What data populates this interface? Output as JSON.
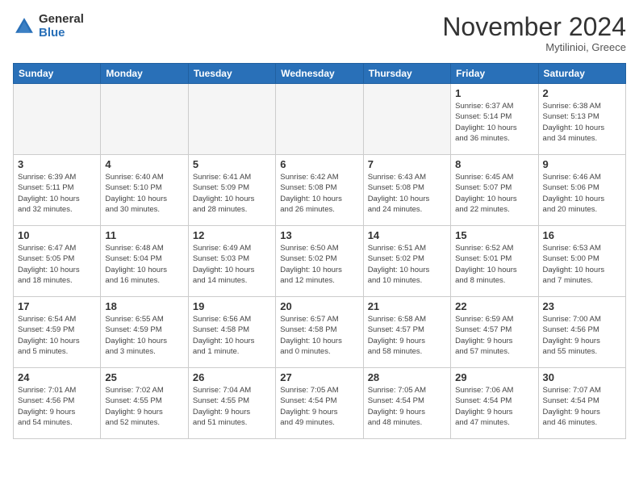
{
  "header": {
    "logo": {
      "general": "General",
      "blue": "Blue"
    },
    "title": "November 2024",
    "location": "Mytilinioi, Greece"
  },
  "weekdays": [
    "Sunday",
    "Monday",
    "Tuesday",
    "Wednesday",
    "Thursday",
    "Friday",
    "Saturday"
  ],
  "weeks": [
    [
      {
        "day": "",
        "info": ""
      },
      {
        "day": "",
        "info": ""
      },
      {
        "day": "",
        "info": ""
      },
      {
        "day": "",
        "info": ""
      },
      {
        "day": "",
        "info": ""
      },
      {
        "day": "1",
        "info": "Sunrise: 6:37 AM\nSunset: 5:14 PM\nDaylight: 10 hours\nand 36 minutes."
      },
      {
        "day": "2",
        "info": "Sunrise: 6:38 AM\nSunset: 5:13 PM\nDaylight: 10 hours\nand 34 minutes."
      }
    ],
    [
      {
        "day": "3",
        "info": "Sunrise: 6:39 AM\nSunset: 5:11 PM\nDaylight: 10 hours\nand 32 minutes."
      },
      {
        "day": "4",
        "info": "Sunrise: 6:40 AM\nSunset: 5:10 PM\nDaylight: 10 hours\nand 30 minutes."
      },
      {
        "day": "5",
        "info": "Sunrise: 6:41 AM\nSunset: 5:09 PM\nDaylight: 10 hours\nand 28 minutes."
      },
      {
        "day": "6",
        "info": "Sunrise: 6:42 AM\nSunset: 5:08 PM\nDaylight: 10 hours\nand 26 minutes."
      },
      {
        "day": "7",
        "info": "Sunrise: 6:43 AM\nSunset: 5:08 PM\nDaylight: 10 hours\nand 24 minutes."
      },
      {
        "day": "8",
        "info": "Sunrise: 6:45 AM\nSunset: 5:07 PM\nDaylight: 10 hours\nand 22 minutes."
      },
      {
        "day": "9",
        "info": "Sunrise: 6:46 AM\nSunset: 5:06 PM\nDaylight: 10 hours\nand 20 minutes."
      }
    ],
    [
      {
        "day": "10",
        "info": "Sunrise: 6:47 AM\nSunset: 5:05 PM\nDaylight: 10 hours\nand 18 minutes."
      },
      {
        "day": "11",
        "info": "Sunrise: 6:48 AM\nSunset: 5:04 PM\nDaylight: 10 hours\nand 16 minutes."
      },
      {
        "day": "12",
        "info": "Sunrise: 6:49 AM\nSunset: 5:03 PM\nDaylight: 10 hours\nand 14 minutes."
      },
      {
        "day": "13",
        "info": "Sunrise: 6:50 AM\nSunset: 5:02 PM\nDaylight: 10 hours\nand 12 minutes."
      },
      {
        "day": "14",
        "info": "Sunrise: 6:51 AM\nSunset: 5:02 PM\nDaylight: 10 hours\nand 10 minutes."
      },
      {
        "day": "15",
        "info": "Sunrise: 6:52 AM\nSunset: 5:01 PM\nDaylight: 10 hours\nand 8 minutes."
      },
      {
        "day": "16",
        "info": "Sunrise: 6:53 AM\nSunset: 5:00 PM\nDaylight: 10 hours\nand 7 minutes."
      }
    ],
    [
      {
        "day": "17",
        "info": "Sunrise: 6:54 AM\nSunset: 4:59 PM\nDaylight: 10 hours\nand 5 minutes."
      },
      {
        "day": "18",
        "info": "Sunrise: 6:55 AM\nSunset: 4:59 PM\nDaylight: 10 hours\nand 3 minutes."
      },
      {
        "day": "19",
        "info": "Sunrise: 6:56 AM\nSunset: 4:58 PM\nDaylight: 10 hours\nand 1 minute."
      },
      {
        "day": "20",
        "info": "Sunrise: 6:57 AM\nSunset: 4:58 PM\nDaylight: 10 hours\nand 0 minutes."
      },
      {
        "day": "21",
        "info": "Sunrise: 6:58 AM\nSunset: 4:57 PM\nDaylight: 9 hours\nand 58 minutes."
      },
      {
        "day": "22",
        "info": "Sunrise: 6:59 AM\nSunset: 4:57 PM\nDaylight: 9 hours\nand 57 minutes."
      },
      {
        "day": "23",
        "info": "Sunrise: 7:00 AM\nSunset: 4:56 PM\nDaylight: 9 hours\nand 55 minutes."
      }
    ],
    [
      {
        "day": "24",
        "info": "Sunrise: 7:01 AM\nSunset: 4:56 PM\nDaylight: 9 hours\nand 54 minutes."
      },
      {
        "day": "25",
        "info": "Sunrise: 7:02 AM\nSunset: 4:55 PM\nDaylight: 9 hours\nand 52 minutes."
      },
      {
        "day": "26",
        "info": "Sunrise: 7:04 AM\nSunset: 4:55 PM\nDaylight: 9 hours\nand 51 minutes."
      },
      {
        "day": "27",
        "info": "Sunrise: 7:05 AM\nSunset: 4:54 PM\nDaylight: 9 hours\nand 49 minutes."
      },
      {
        "day": "28",
        "info": "Sunrise: 7:05 AM\nSunset: 4:54 PM\nDaylight: 9 hours\nand 48 minutes."
      },
      {
        "day": "29",
        "info": "Sunrise: 7:06 AM\nSunset: 4:54 PM\nDaylight: 9 hours\nand 47 minutes."
      },
      {
        "day": "30",
        "info": "Sunrise: 7:07 AM\nSunset: 4:54 PM\nDaylight: 9 hours\nand 46 minutes."
      }
    ]
  ]
}
